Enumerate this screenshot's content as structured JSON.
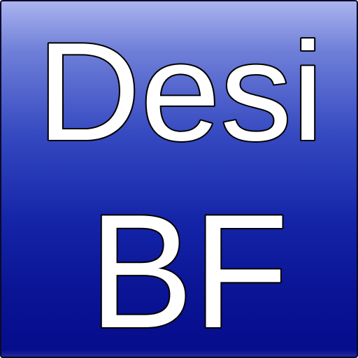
{
  "logo": {
    "line1": "Desi",
    "line2": "BF",
    "text_color": "#ffffff",
    "outline_color": "#000000",
    "gradient_top": "#aab4ee",
    "gradient_bottom": "#050c8c"
  }
}
